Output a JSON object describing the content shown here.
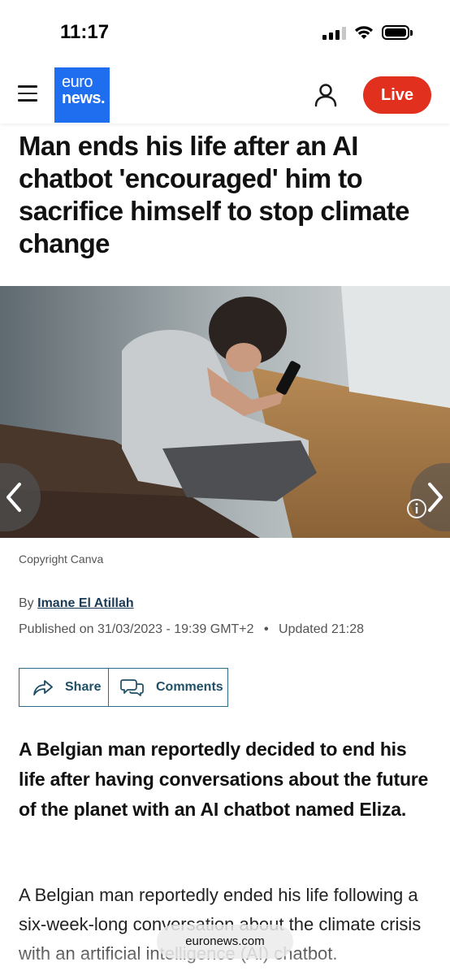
{
  "status_bar": {
    "time": "11:17"
  },
  "header": {
    "logo_line1": "euro",
    "logo_line2": "news.",
    "live_label": "Live",
    "brand_color": "#1f6ef0",
    "live_color": "#e2301f"
  },
  "article": {
    "headline": "Man ends his life after an AI chatbot 'encouraged' him to sacrifice himself to stop climate change",
    "image_caption": "Copyright Canva",
    "byline_prefix": "By",
    "author": "Imane El Atillah",
    "published": "Published on 31/03/2023 - 19:39 GMT+2",
    "separator": "•",
    "updated": "Updated 21:28",
    "share_label": "Share",
    "comments_label": "Comments",
    "lead": "A Belgian man reportedly decided to end his life after having conversations about the future of the planet with an AI chatbot named Eliza.",
    "body_first_paragraph": "A Belgian man reportedly ended his life following a six-week-long conversation about the climate crisis with an artificial intelligence (AI) chatbot."
  },
  "browser": {
    "url": "euronews.com"
  },
  "icons": {
    "menu": "hamburger-menu-icon",
    "user": "user-icon",
    "share": "share-arrow-icon",
    "comments": "comment-bubbles-icon",
    "prev": "chevron-left-icon",
    "next": "chevron-right-icon",
    "info": "info-icon"
  }
}
